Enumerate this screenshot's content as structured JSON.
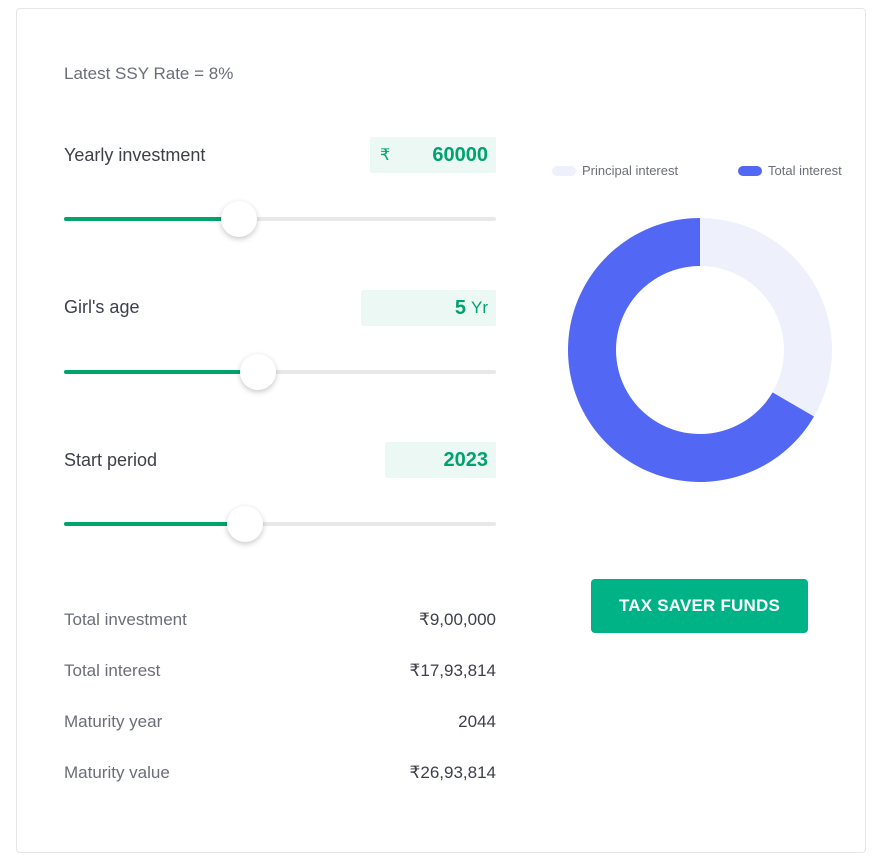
{
  "rate_text": "Latest SSY Rate = 8%",
  "inputs": [
    {
      "label": "Yearly investment",
      "prefix": "₹",
      "value": "60000",
      "suffix": "",
      "slider_fraction": 0.405
    },
    {
      "label": "Girl's age",
      "prefix": "",
      "value": "5",
      "suffix": "Yr",
      "slider_fraction": 0.45
    },
    {
      "label": "Start period",
      "prefix": "",
      "value": "2023",
      "suffix": "",
      "slider_fraction": 0.42
    }
  ],
  "summary": [
    {
      "label": "Total investment",
      "value": "₹9,00,000"
    },
    {
      "label": "Total interest",
      "value": "₹17,93,814"
    },
    {
      "label": "Maturity year",
      "value": "2044"
    },
    {
      "label": "Maturity value",
      "value": "₹26,93,814"
    }
  ],
  "legend": {
    "principal": "Principal interest",
    "total": "Total interest"
  },
  "chart_data": {
    "type": "pie",
    "variant": "donut",
    "slices": [
      {
        "name": "Principal interest",
        "value": 900000,
        "color": "#eef0fc"
      },
      {
        "name": "Total interest",
        "value": 1793814,
        "color": "#5367f5"
      }
    ],
    "legend_position": "top"
  },
  "cta_label": "TAX SAVER FUNDS",
  "colors": {
    "accent": "#00a26e",
    "button": "#00b386",
    "total_interest": "#5367f5",
    "principal": "#eef0fc"
  }
}
